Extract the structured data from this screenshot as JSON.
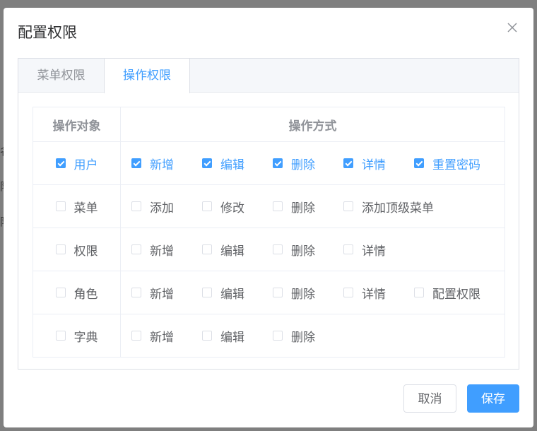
{
  "background_peek": [
    "名",
    "限",
    "限"
  ],
  "dialog": {
    "title": "配置权限",
    "close_icon": "close-icon"
  },
  "tabs": [
    {
      "label": "菜单权限",
      "active": false
    },
    {
      "label": "操作权限",
      "active": true
    }
  ],
  "table": {
    "headers": [
      "操作对象",
      "操作方式"
    ],
    "rows": [
      {
        "object": {
          "label": "用户",
          "checked": true
        },
        "operations": [
          {
            "label": "新增",
            "checked": true
          },
          {
            "label": "编辑",
            "checked": true
          },
          {
            "label": "删除",
            "checked": true
          },
          {
            "label": "详情",
            "checked": true
          },
          {
            "label": "重置密码",
            "checked": true
          }
        ]
      },
      {
        "object": {
          "label": "菜单",
          "checked": false
        },
        "operations": [
          {
            "label": "添加",
            "checked": false
          },
          {
            "label": "修改",
            "checked": false
          },
          {
            "label": "删除",
            "checked": false
          },
          {
            "label": "添加顶级菜单",
            "checked": false
          }
        ]
      },
      {
        "object": {
          "label": "权限",
          "checked": false
        },
        "operations": [
          {
            "label": "新增",
            "checked": false
          },
          {
            "label": "编辑",
            "checked": false
          },
          {
            "label": "删除",
            "checked": false
          },
          {
            "label": "详情",
            "checked": false
          }
        ]
      },
      {
        "object": {
          "label": "角色",
          "checked": false
        },
        "operations": [
          {
            "label": "新增",
            "checked": false
          },
          {
            "label": "编辑",
            "checked": false
          },
          {
            "label": "删除",
            "checked": false
          },
          {
            "label": "详情",
            "checked": false
          },
          {
            "label": "配置权限",
            "checked": false
          }
        ]
      },
      {
        "object": {
          "label": "字典",
          "checked": false
        },
        "operations": [
          {
            "label": "新增",
            "checked": false
          },
          {
            "label": "编辑",
            "checked": false
          },
          {
            "label": "删除",
            "checked": false
          }
        ]
      }
    ]
  },
  "footer": {
    "cancel_label": "取消",
    "save_label": "保存"
  },
  "colors": {
    "accent": "#409eff",
    "overlay": "#7f7f7f",
    "text": "#606266",
    "muted": "#909399",
    "border": "#ebeef5"
  }
}
